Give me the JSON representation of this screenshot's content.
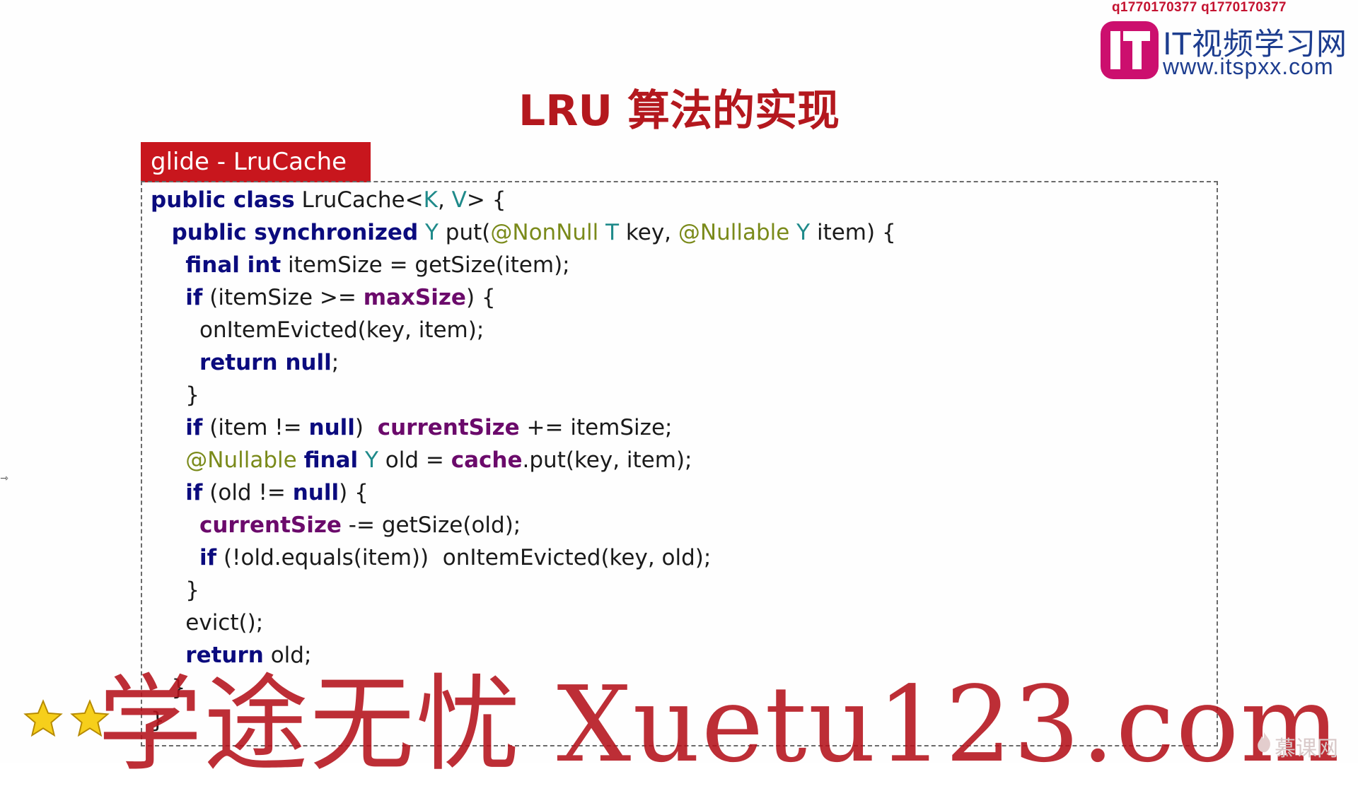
{
  "watermark_top": "q1770170377 q1770170377",
  "brand": {
    "name": "IT视频学习网",
    "url": "www.itspxx.com"
  },
  "slide_title": "LRU 算法的实现",
  "code_block": {
    "label": "glide - LruCache",
    "lines": [
      [
        {
          "t": "public class",
          "c": "kw"
        },
        {
          "t": " LruCache<",
          "c": ""
        },
        {
          "t": "K",
          "c": "tp"
        },
        {
          "t": ", ",
          "c": ""
        },
        {
          "t": "V",
          "c": "tp"
        },
        {
          "t": "> {",
          "c": ""
        }
      ],
      [
        {
          "t": "   ",
          "c": ""
        },
        {
          "t": "public synchronized",
          "c": "kw"
        },
        {
          "t": " ",
          "c": ""
        },
        {
          "t": "Y",
          "c": "tp"
        },
        {
          "t": " put(",
          "c": ""
        },
        {
          "t": "@NonNull",
          "c": "an"
        },
        {
          "t": " ",
          "c": ""
        },
        {
          "t": "T",
          "c": "tp"
        },
        {
          "t": " key, ",
          "c": ""
        },
        {
          "t": "@Nullable",
          "c": "an"
        },
        {
          "t": " ",
          "c": ""
        },
        {
          "t": "Y",
          "c": "tp"
        },
        {
          "t": " item) {",
          "c": ""
        }
      ],
      [
        {
          "t": "     ",
          "c": ""
        },
        {
          "t": "final int",
          "c": "kw"
        },
        {
          "t": " itemSize = getSize(item);",
          "c": ""
        }
      ],
      [
        {
          "t": "     ",
          "c": ""
        },
        {
          "t": "if",
          "c": "kw"
        },
        {
          "t": " (itemSize >= ",
          "c": ""
        },
        {
          "t": "maxSize",
          "c": "fld"
        },
        {
          "t": ") {",
          "c": ""
        }
      ],
      [
        {
          "t": "       onItemEvicted(key, item);",
          "c": ""
        }
      ],
      [
        {
          "t": "       ",
          "c": ""
        },
        {
          "t": "return null",
          "c": "kw"
        },
        {
          "t": ";",
          "c": ""
        }
      ],
      [
        {
          "t": "     }",
          "c": ""
        }
      ],
      [
        {
          "t": "     ",
          "c": ""
        },
        {
          "t": "if",
          "c": "kw"
        },
        {
          "t": " (item != ",
          "c": ""
        },
        {
          "t": "null",
          "c": "kw"
        },
        {
          "t": ")  ",
          "c": ""
        },
        {
          "t": "currentSize",
          "c": "fld"
        },
        {
          "t": " += itemSize;",
          "c": ""
        }
      ],
      [
        {
          "t": "     ",
          "c": ""
        },
        {
          "t": "@Nullable",
          "c": "an"
        },
        {
          "t": " ",
          "c": ""
        },
        {
          "t": "final",
          "c": "kw"
        },
        {
          "t": " ",
          "c": ""
        },
        {
          "t": "Y",
          "c": "tp"
        },
        {
          "t": " old = ",
          "c": ""
        },
        {
          "t": "cache",
          "c": "fld"
        },
        {
          "t": ".put(key, item);",
          "c": ""
        }
      ],
      [
        {
          "t": "     ",
          "c": ""
        },
        {
          "t": "if",
          "c": "kw"
        },
        {
          "t": " (old != ",
          "c": ""
        },
        {
          "t": "null",
          "c": "kw"
        },
        {
          "t": ") {",
          "c": ""
        }
      ],
      [
        {
          "t": "       ",
          "c": ""
        },
        {
          "t": "currentSize",
          "c": "fld"
        },
        {
          "t": " -= getSize(old);",
          "c": ""
        }
      ],
      [
        {
          "t": "       ",
          "c": ""
        },
        {
          "t": "if",
          "c": "kw"
        },
        {
          "t": " (!old.equals(item))  onItemEvicted(key, old);",
          "c": ""
        }
      ],
      [
        {
          "t": "     }",
          "c": ""
        }
      ],
      [
        {
          "t": "     evict();",
          "c": ""
        }
      ],
      [
        {
          "t": "     ",
          "c": ""
        },
        {
          "t": "return",
          "c": "kw"
        },
        {
          "t": " old;",
          "c": ""
        }
      ],
      [
        {
          "t": "   }",
          "c": ""
        }
      ],
      [
        {
          "t": "}",
          "c": ""
        }
      ]
    ]
  },
  "overlay_watermark": "学途无忧 Xuetu123.com",
  "bottom_brand": "慕课网",
  "colors": {
    "title": "#b4181e",
    "label_bg": "#c8161d",
    "keyword": "#0b0b7e",
    "field": "#6b0a6b",
    "annotation": "#7a8a1a",
    "type_param": "#1f8a8a",
    "brand_blue": "#1d3d8f",
    "logo_magenta": "#cc0f6e",
    "overlay_red": "#b5121b"
  },
  "icons": {
    "logo": "it-logo-icon",
    "star": "star-icon",
    "flame": "flame-icon"
  }
}
